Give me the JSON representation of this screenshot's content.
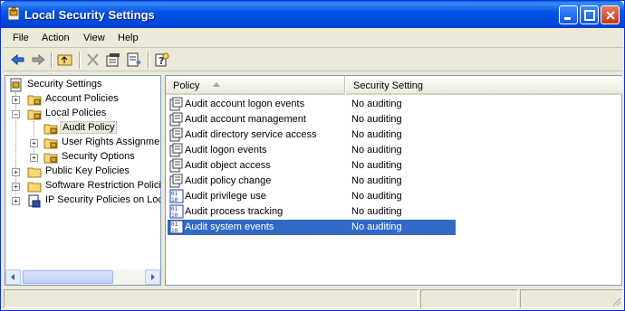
{
  "window": {
    "title": "Local Security Settings",
    "title_icon": "security-settings-icon",
    "controls": [
      "minimize",
      "maximize",
      "close"
    ]
  },
  "menu": {
    "file": "File",
    "action": "Action",
    "view": "View",
    "help": "Help"
  },
  "toolbar": {
    "icons": [
      "back-arrow-icon",
      "forward-arrow-icon",
      "up-folder-icon",
      "delete-icon",
      "properties-icon",
      "export-list-icon",
      "help-icon"
    ]
  },
  "tree": {
    "root": "Security Settings",
    "account_policies": "Account Policies",
    "local_policies": "Local Policies",
    "audit_policy": "Audit Policy",
    "user_rights": "User Rights Assignmer",
    "security_options": "Security Options",
    "public_key": "Public Key Policies",
    "software_restriction": "Software Restriction Policie",
    "ip_security": "IP Security Policies on Loca"
  },
  "list": {
    "columns": {
      "policy": "Policy",
      "setting": "Security Setting"
    },
    "rows": [
      {
        "name": "Audit account logon events",
        "value": "No auditing",
        "icon": "policy-icon"
      },
      {
        "name": "Audit account management",
        "value": "No auditing",
        "icon": "policy-icon"
      },
      {
        "name": "Audit directory service access",
        "value": "No auditing",
        "icon": "policy-icon"
      },
      {
        "name": "Audit logon events",
        "value": "No auditing",
        "icon": "policy-icon"
      },
      {
        "name": "Audit object access",
        "value": "No auditing",
        "icon": "policy-icon"
      },
      {
        "name": "Audit policy change",
        "value": "No auditing",
        "icon": "policy-icon"
      },
      {
        "name": "Audit privilege use",
        "value": "No auditing",
        "icon": "binary-policy-icon"
      },
      {
        "name": "Audit process tracking",
        "value": "No auditing",
        "icon": "binary-policy-icon"
      },
      {
        "name": "Audit system events",
        "value": "No auditing",
        "icon": "binary-policy-icon"
      }
    ],
    "selected_row": "Audit system events"
  },
  "colors": {
    "titlebar": "#0454e6",
    "selection": "#316ac5",
    "window_face": "#ece9d8"
  }
}
